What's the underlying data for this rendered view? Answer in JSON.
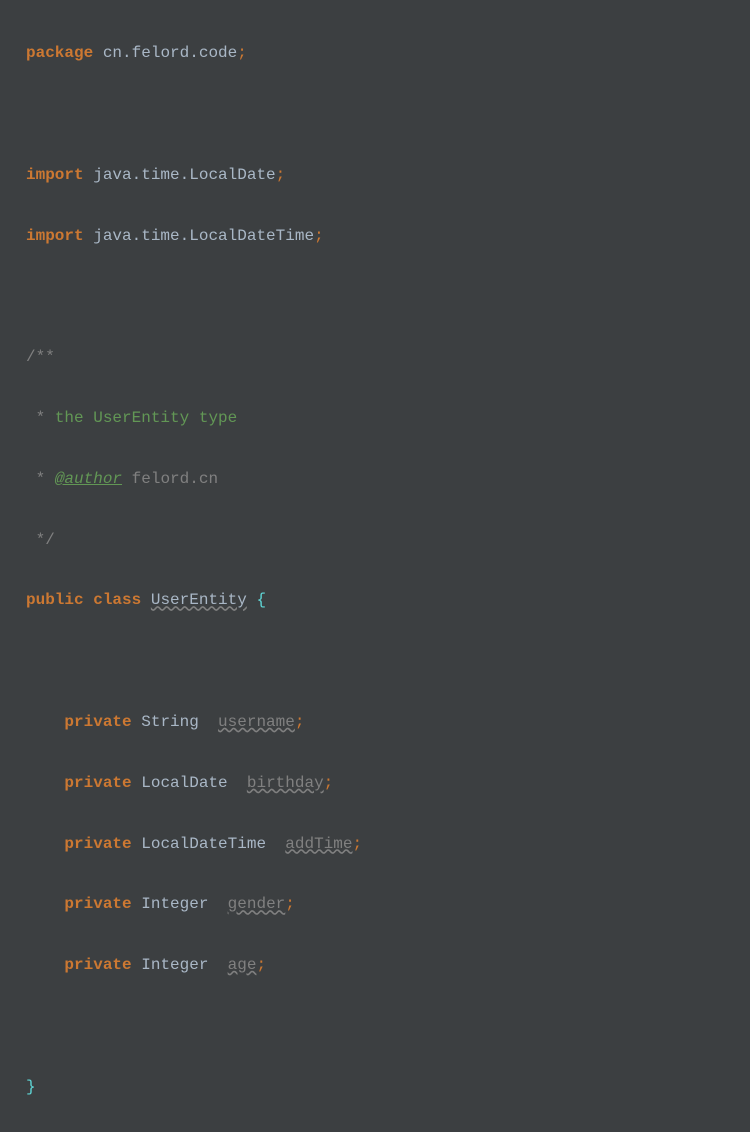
{
  "code": {
    "packageKw": "package",
    "packageName": "cn.felord.code",
    "importKw": "import",
    "import1": "java.time.LocalDate",
    "import2": "java.time.LocalDateTime",
    "docOpen": "/**",
    "docLine1Star": " * ",
    "docLine1Text": "the UserEntity type",
    "docLine2Star": " * ",
    "docAuthorTag": "@author",
    "docAuthorVal": " felord.cn",
    "docClose": " */",
    "publicKw": "public",
    "classKw": "class",
    "className": "UserEntity",
    "braceOpen": "{",
    "braceClose": "}",
    "privateKw": "private",
    "typeString": "String",
    "typeLocalDate": "LocalDate",
    "typeLocalDateTime": "LocalDateTime",
    "typeInteger": "Integer",
    "fieldUsername": "username",
    "fieldBirthday": "birthday",
    "fieldAddTime": "addTime",
    "fieldGender": "gender",
    "fieldAge": "age",
    "semi": ";"
  }
}
